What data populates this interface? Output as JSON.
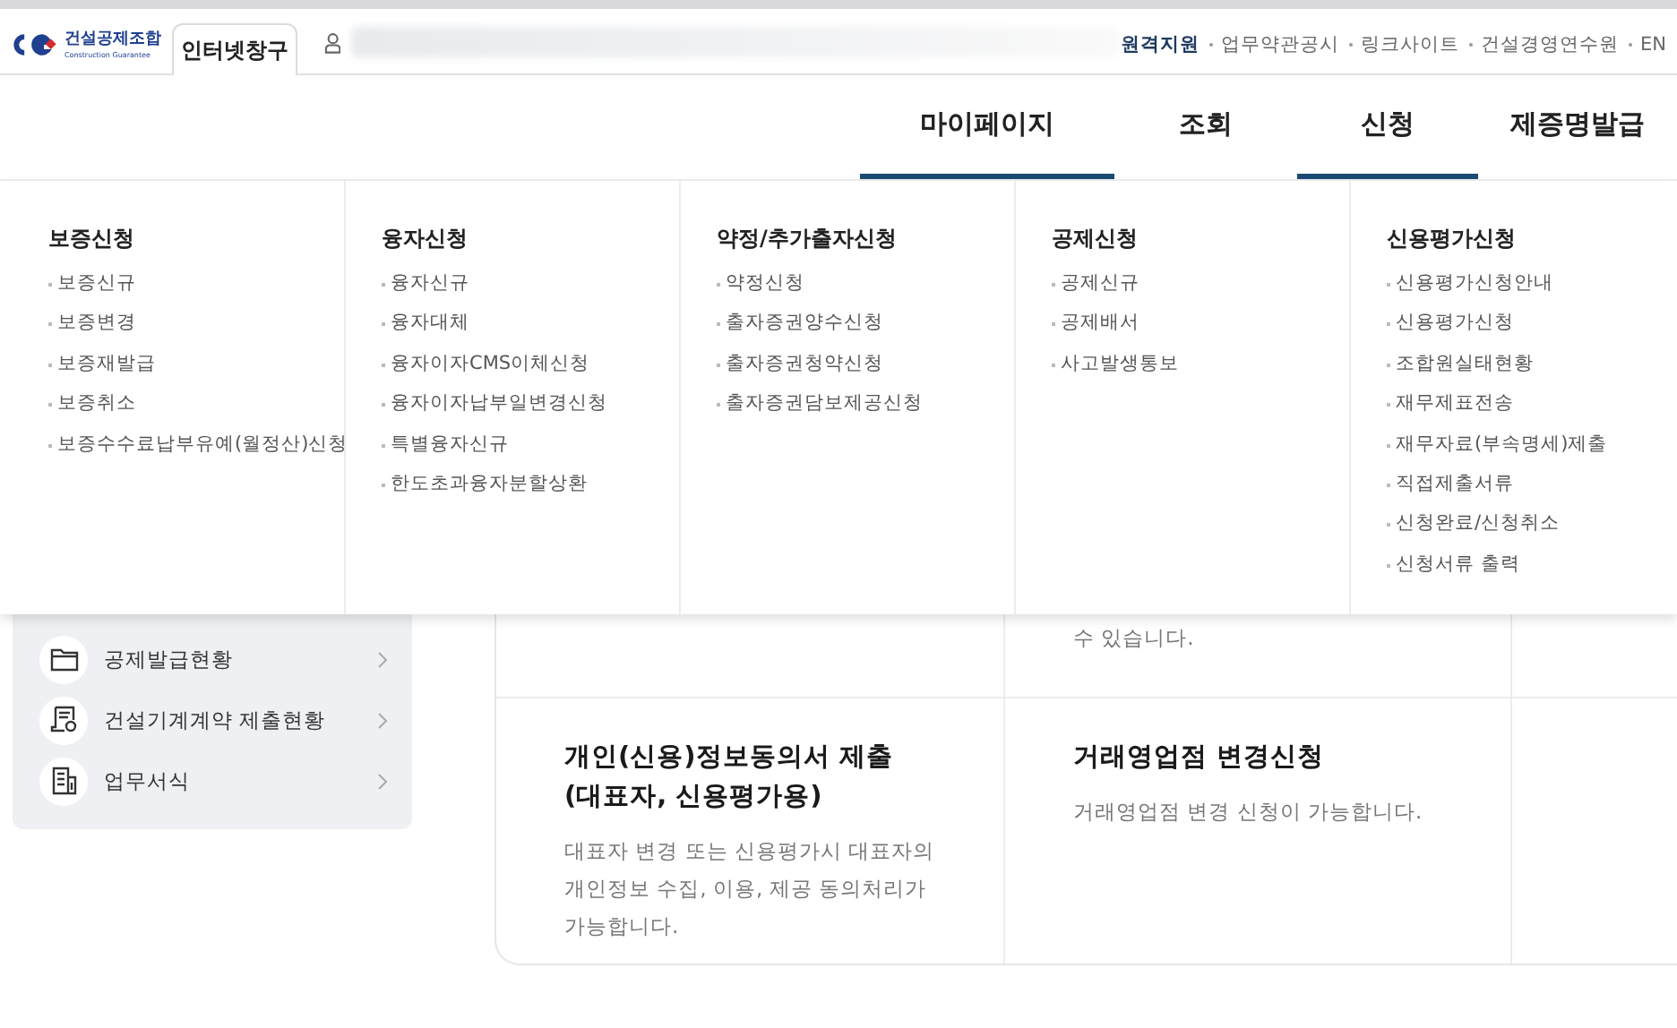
{
  "header": {
    "logo": {
      "name": "건설공제조합",
      "subtitle": "Construction Guarantee"
    },
    "tab": "인터넷창구",
    "links": [
      {
        "label": "원격지원",
        "emphasis": true
      },
      {
        "label": "업무약관공시",
        "emphasis": false
      },
      {
        "label": "링크사이트",
        "emphasis": false
      },
      {
        "label": "건설경영연수원",
        "emphasis": false
      },
      {
        "label": "EN",
        "emphasis": false
      }
    ]
  },
  "nav": [
    {
      "label": "마이페이지",
      "selected": true
    },
    {
      "label": "조회",
      "selected": false
    },
    {
      "label": "신청",
      "selected": true
    },
    {
      "label": "제증명발급",
      "selected": false
    }
  ],
  "mega_menu": [
    {
      "heading": "보증신청",
      "items": [
        "보증신규",
        "보증변경",
        "보증재발급",
        "보증취소",
        "보증수수료납부유예(월정산)신청"
      ]
    },
    {
      "heading": "융자신청",
      "items": [
        "융자신규",
        "융자대체",
        "융자이자CMS이체신청",
        "융자이자납부일변경신청",
        "특별융자신규",
        "한도초과융자분할상환"
      ]
    },
    {
      "heading": "약정/추가출자신청",
      "items": [
        "약정신청",
        "출자증권양수신청",
        "출자증권청약신청",
        "출자증권담보제공신청"
      ]
    },
    {
      "heading": "공제신청",
      "items": [
        "공제신규",
        "공제배서",
        "사고발생통보"
      ]
    },
    {
      "heading": "신용평가신청",
      "items": [
        "신용평가신청안내",
        "신용평가신청",
        "조합원실태현황",
        "재무제표전송",
        "재무자료(부속명세)제출",
        "직접제출서류",
        "신청완료/신청취소",
        "신청서류 출력"
      ]
    }
  ],
  "sidebar": [
    {
      "label": "공제발급현황",
      "kind": "folder"
    },
    {
      "label": "건설기계계약 제출현황",
      "kind": "contract"
    },
    {
      "label": "업무서식",
      "kind": "forms"
    }
  ],
  "cards": [
    [
      {
        "kind": "empty"
      },
      {
        "kind": "text",
        "description": "수 있습니다."
      },
      {
        "kind": "empty"
      }
    ],
    [
      {
        "kind": "text",
        "title": "개인(신용)정보동의서 제출\n(대표자, 신용평가용)",
        "description": "대표자 변경 또는 신용평가시 대표자의\n개인정보 수집, 이용, 제공 동의처리가\n가능합니다."
      },
      {
        "kind": "text",
        "title": "거래영업점 변경신청",
        "description": "거래영업점 변경 신청이 가능합니다."
      },
      {
        "kind": "empty"
      }
    ]
  ]
}
